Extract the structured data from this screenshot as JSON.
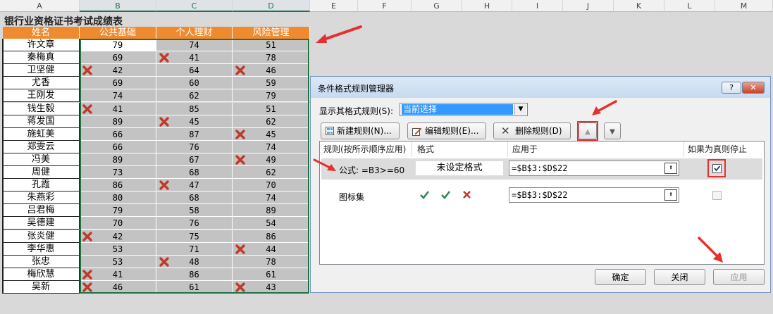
{
  "column_headers": [
    "A",
    "B",
    "C",
    "D",
    "E",
    "F",
    "G",
    "H",
    "I",
    "J",
    "K",
    "L",
    "M"
  ],
  "sheet": {
    "title": "银行业资格证书考试成绩表",
    "headers": [
      "姓名",
      "公共基础",
      "个人理财",
      "风险管理"
    ],
    "rows": [
      {
        "name": "许文章",
        "b": "79",
        "c": "74",
        "d": "51"
      },
      {
        "name": "秦梅真",
        "b": "69",
        "c": "41",
        "d": "78"
      },
      {
        "name": "卫坚健",
        "b": "42",
        "c": "64",
        "d": "46"
      },
      {
        "name": "尤香",
        "b": "69",
        "c": "60",
        "d": "59"
      },
      {
        "name": "王刚发",
        "b": "74",
        "c": "62",
        "d": "79"
      },
      {
        "name": "钱生毅",
        "b": "41",
        "c": "85",
        "d": "51"
      },
      {
        "name": "蒋发国",
        "b": "89",
        "c": "45",
        "d": "62"
      },
      {
        "name": "施虹美",
        "b": "66",
        "c": "87",
        "d": "45"
      },
      {
        "name": "郑雯云",
        "b": "66",
        "c": "76",
        "d": "74"
      },
      {
        "name": "冯美",
        "b": "89",
        "c": "67",
        "d": "49"
      },
      {
        "name": "周健",
        "b": "73",
        "c": "68",
        "d": "62"
      },
      {
        "name": "孔霞",
        "b": "86",
        "c": "47",
        "d": "70"
      },
      {
        "name": "朱燕彩",
        "b": "80",
        "c": "68",
        "d": "74"
      },
      {
        "name": "吕君梅",
        "b": "79",
        "c": "58",
        "d": "89"
      },
      {
        "name": "吴德建",
        "b": "70",
        "c": "76",
        "d": "54"
      },
      {
        "name": "张炎健",
        "b": "42",
        "c": "75",
        "d": "86"
      },
      {
        "name": "李华惠",
        "b": "53",
        "c": "71",
        "d": "44"
      },
      {
        "name": "张忠",
        "b": "53",
        "c": "48",
        "d": "78"
      },
      {
        "name": "梅欣慧",
        "b": "41",
        "c": "86",
        "d": "61"
      },
      {
        "name": "吴新",
        "b": "46",
        "c": "61",
        "d": "43"
      }
    ]
  },
  "dialog": {
    "title": "条件格式规则管理器",
    "help_label": "?",
    "close_label": "✕",
    "show_rules_label": "显示其格式规则(S):",
    "show_rules_value": "当前选择",
    "buttons": {
      "new_rule": "新建规则(N)...",
      "edit_rule": "编辑规则(E)...",
      "delete_rule": "删除规则(D)"
    },
    "columns": {
      "rule": "规则(按所示顺序应用)",
      "format": "格式",
      "applies_to": "应用于",
      "stop_if_true": "如果为真则停止"
    },
    "rules": [
      {
        "rule": "公式: =B3>=60",
        "format": "未设定格式",
        "applies_to": "=$B$3:$D$22",
        "stop": true
      },
      {
        "rule": "图标集",
        "format": "",
        "applies_to": "=$B$3:$D$22",
        "stop": false
      }
    ],
    "footer": {
      "ok": "确定",
      "close": "关闭",
      "apply": "应用"
    }
  },
  "colors": {
    "header_orange": "#f08a2e",
    "excel_green": "#217346",
    "cross_red": "#c0392b",
    "check_green": "#2e8b57",
    "annotation_red": "#e53030"
  }
}
